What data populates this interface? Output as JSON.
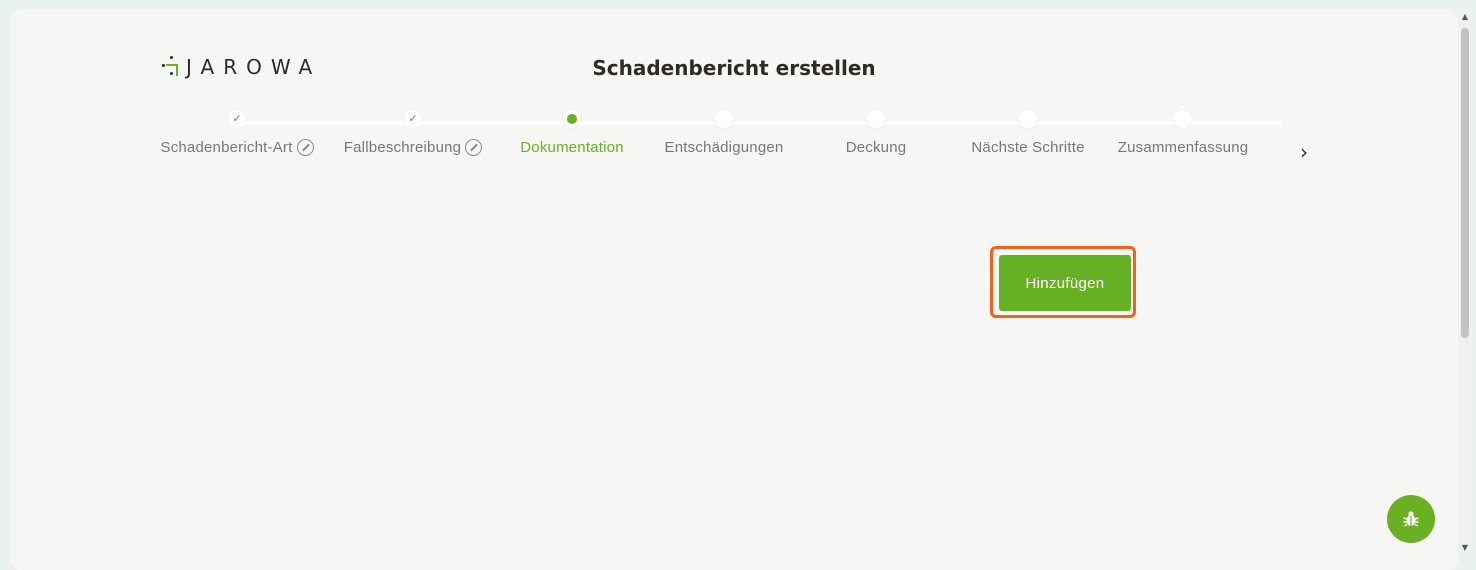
{
  "brand": {
    "logo_text": "JAROWA",
    "accent_color": "#6ab023"
  },
  "header": {
    "title": "Schadenbericht erstellen"
  },
  "stepper": {
    "steps": [
      {
        "label": "Schadenbericht-Art",
        "state": "completed",
        "editable": true
      },
      {
        "label": "Fallbeschreibung",
        "state": "completed",
        "editable": true
      },
      {
        "label": "Dokumentation",
        "state": "active",
        "editable": false
      },
      {
        "label": "Entschädigungen",
        "state": "pending",
        "editable": false
      },
      {
        "label": "Deckung",
        "state": "pending",
        "editable": false
      },
      {
        "label": "Nächste Schritte",
        "state": "pending",
        "editable": false
      },
      {
        "label": "Zusammenfassung",
        "state": "pending",
        "editable": false
      }
    ],
    "next_icon": "chevron-right-icon"
  },
  "main": {
    "add_button_label": "Hinzufügen"
  },
  "floating": {
    "icon": "bug-icon"
  }
}
